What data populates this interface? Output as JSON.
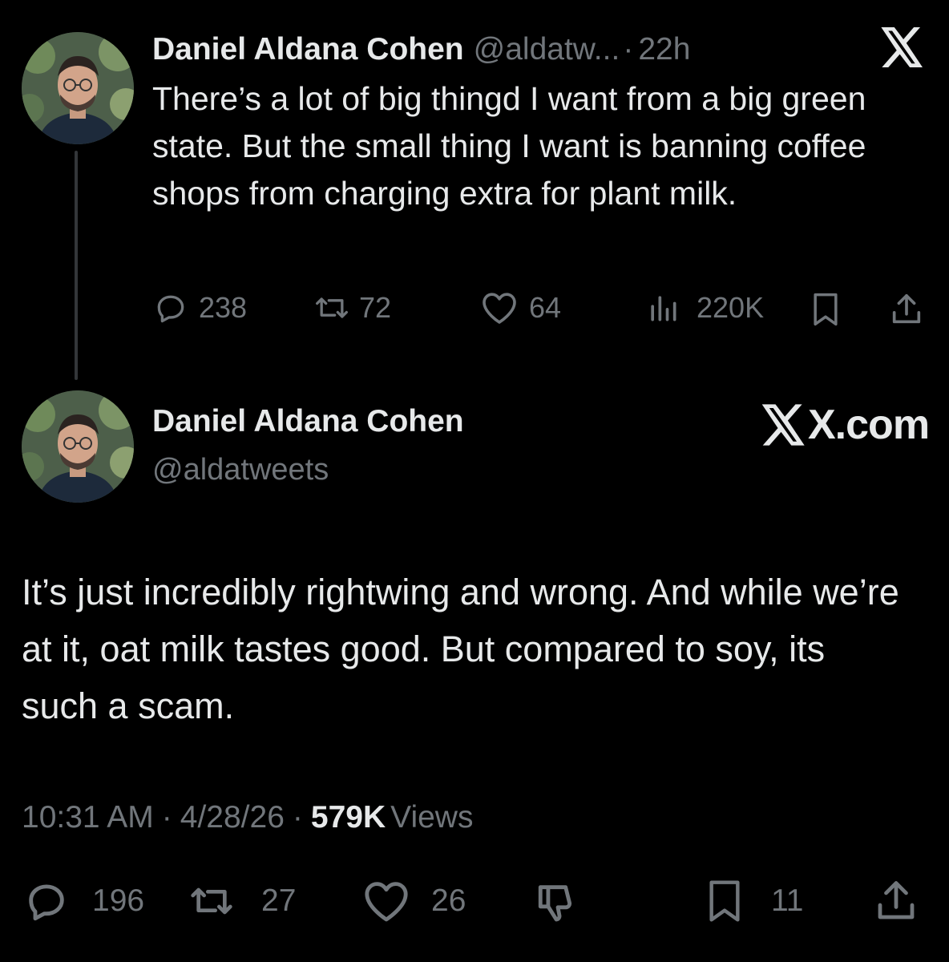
{
  "parent_tweet": {
    "author_name": "Daniel Aldana Cohen",
    "handle_truncated": "@aldatw...",
    "separator": "·",
    "time_ago": "22h",
    "text": "There’s a lot of big thingd I want from a big green state. But the small thing I want is banning coffee shops from charging extra for plant milk.",
    "replies": "238",
    "reposts": "72",
    "likes": "64",
    "views": "220K"
  },
  "main_tweet": {
    "author_name": "Daniel Aldana Cohen",
    "handle": "@aldatweets",
    "text": "It’s just incredibly rightwing and wrong. And while we’re at it, oat milk tastes good. But compared to soy, its such a scam.",
    "time": "10:31 AM",
    "date": "4/28/26",
    "views_count": "579K",
    "views_label": "Views",
    "sep": "·",
    "replies": "196",
    "reposts": "27",
    "likes": "26",
    "bookmarks": "11"
  },
  "watermark": {
    "logo_glyph": "𝕏",
    "label": "X.com"
  },
  "icons": {
    "reply": "reply-icon",
    "repost": "repost-icon",
    "like": "heart-icon",
    "views": "views-icon",
    "bookmark": "bookmark-icon",
    "share": "share-icon",
    "dislike": "dislike-icon",
    "x_logo": "x-logo-icon"
  },
  "colors": {
    "background": "#000000",
    "text": "#e7e9ea",
    "muted": "#71767b",
    "thread_line": "#333639"
  }
}
